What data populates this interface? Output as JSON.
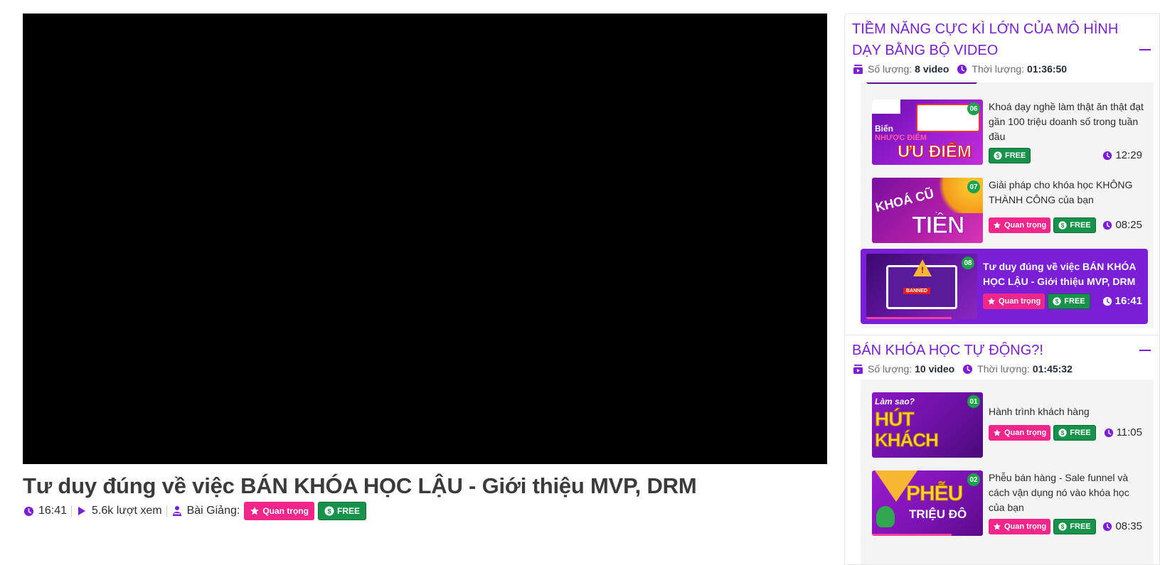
{
  "video": {
    "title": "Tư duy đúng về việc BÁN KHÓA HỌC LẬU - Giới thiệu MVP, DRM",
    "duration": "16:41",
    "views": "5.6k lượt xem",
    "lesson_label": "Bài Giảng:",
    "badge_important": "Quan trọng",
    "badge_free": "FREE"
  },
  "colors": {
    "accent": "#7a1fd6",
    "important": "#f0268b",
    "free": "#17924a"
  },
  "sections": [
    {
      "title": "TIỀM NĂNG CỰC KÌ LỚN CỦA MÔ HÌNH DẠY BẰNG BỘ VIDEO",
      "count_label": "Số lượng:",
      "count_value": "8 video",
      "duration_label": "Thời lượng:",
      "duration_value": "01:36:50",
      "items": [
        {
          "num": "06",
          "title": "Khoá dạy nghề làm thật ăn thật đạt gần 100 triệu doanh số trong tuần đầu",
          "badges": [
            "FREE"
          ],
          "duration": "12:29",
          "thumb_text": [
            "Biến",
            "NHƯỢC ĐIỂM",
            "ƯU ĐIỂM"
          ]
        },
        {
          "num": "07",
          "title": "Giải pháp cho khóa học KHÔNG THÀNH CÔNG của bạn",
          "badges": [
            "Quan trọng",
            "FREE"
          ],
          "duration": "08:25",
          "thumb_text": [
            "KHOÁ CŨ",
            "TIỀN"
          ]
        },
        {
          "num": "08",
          "title": "Tư duy đúng về việc BÁN KHÓA HỌC LẬU - Giới thiệu MVP, DRM",
          "badges": [
            "Quan trọng",
            "FREE"
          ],
          "duration": "16:41",
          "active": true,
          "thumb_text": [
            "BANNED"
          ]
        }
      ]
    },
    {
      "title": "BÁN KHÓA HỌC TỰ ĐỘNG?!",
      "count_label": "Số lượng:",
      "count_value": "10 video",
      "duration_label": "Thời lượng:",
      "duration_value": "01:45:32",
      "items": [
        {
          "num": "01",
          "title": "Hành trình khách hàng",
          "badges": [
            "Quan trọng",
            "FREE"
          ],
          "duration": "11:05",
          "thumb_text": [
            "Làm sao?",
            "HÚT",
            "KHÁCH"
          ]
        },
        {
          "num": "02",
          "title": "Phễu bán hàng - Sale funnel và cách vận dụng nó vào khóa học của bạn",
          "badges": [
            "Quan trọng",
            "FREE"
          ],
          "duration": "08:35",
          "thumb_text": [
            "PHỄU",
            "TRIỆU ĐÔ"
          ]
        }
      ]
    }
  ]
}
